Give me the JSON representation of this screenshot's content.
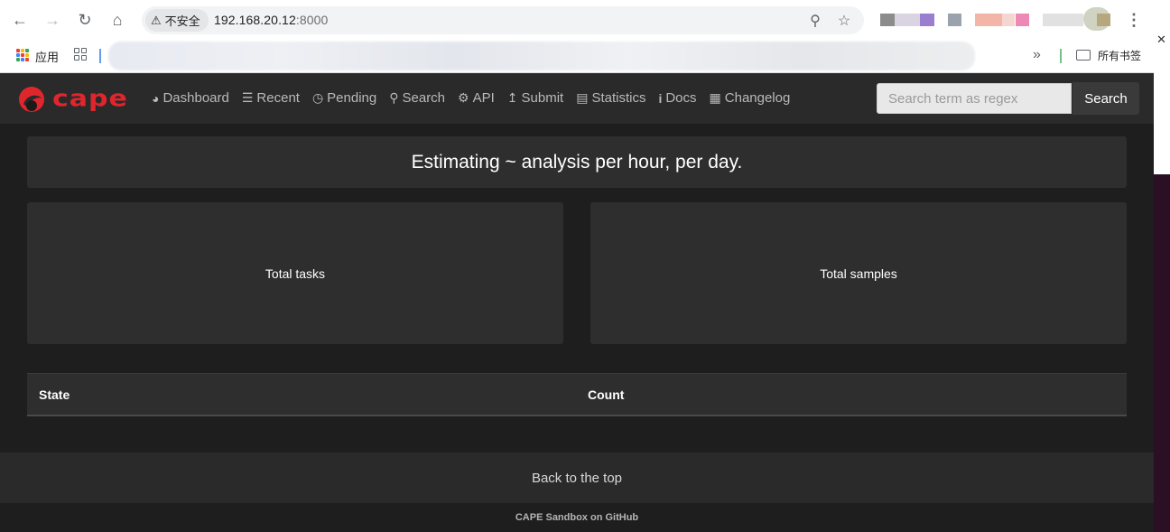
{
  "browser": {
    "security_label": "不安全",
    "url_host": "192.168.20.12",
    "url_port": ":8000",
    "bookmarks": {
      "apps_label": "应用",
      "folder_label": "所有书签"
    }
  },
  "navbar": {
    "brand": "cape",
    "links": [
      {
        "label": "Dashboard",
        "icon": "dashboard-icon"
      },
      {
        "label": "Recent",
        "icon": "list-icon"
      },
      {
        "label": "Pending",
        "icon": "clock-icon"
      },
      {
        "label": "Search",
        "icon": "search-icon"
      },
      {
        "label": "API",
        "icon": "gear-icon"
      },
      {
        "label": "Submit",
        "icon": "upload-icon"
      },
      {
        "label": "Statistics",
        "icon": "chart-icon"
      },
      {
        "label": "Docs",
        "icon": "info-icon"
      },
      {
        "label": "Changelog",
        "icon": "calendar-icon"
      }
    ],
    "search_placeholder": "Search term as regex",
    "search_button": "Search"
  },
  "main": {
    "estimate_heading": "Estimating ~ analysis per hour, per day.",
    "total_tasks_label": "Total tasks",
    "total_samples_label": "Total samples",
    "table": {
      "columns": [
        "State",
        "Count"
      ]
    }
  },
  "footer": {
    "back_to_top": "Back to the top",
    "github_link": "CAPE Sandbox on GitHub"
  },
  "colors": {
    "brand_red": "#e0262d",
    "page_bg": "#1e1e1e",
    "navbar_bg": "#2a2a2a",
    "panel_bg": "#2e2e2e"
  }
}
